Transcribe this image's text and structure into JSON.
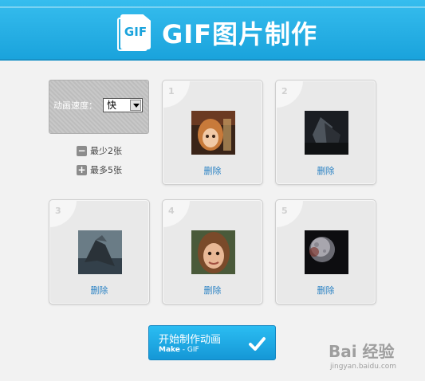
{
  "header": {
    "logo_text": "GIF",
    "title": "GIF图片制作"
  },
  "speed": {
    "label": "动画速度：",
    "selected": "快"
  },
  "limits": {
    "min_label": "最少2张",
    "min_icon": "minus-icon",
    "max_label": "最多5张",
    "max_icon": "plus-icon"
  },
  "slots": [
    {
      "num": "1",
      "delete_label": "删除"
    },
    {
      "num": "2",
      "delete_label": "删除"
    },
    {
      "num": "3",
      "delete_label": "删除"
    },
    {
      "num": "4",
      "delete_label": "删除"
    },
    {
      "num": "5",
      "delete_label": "删除"
    }
  ],
  "make_button": {
    "label": "开始制作动画",
    "sub_bold": "Make",
    "sub_rest": " - GIF"
  },
  "watermark": {
    "main": "Bai 经验",
    "sub": "jingyan.baidu.com"
  },
  "colors": {
    "header": "#1aa3dc",
    "button": "#1597d6",
    "link": "#2a82c4"
  }
}
